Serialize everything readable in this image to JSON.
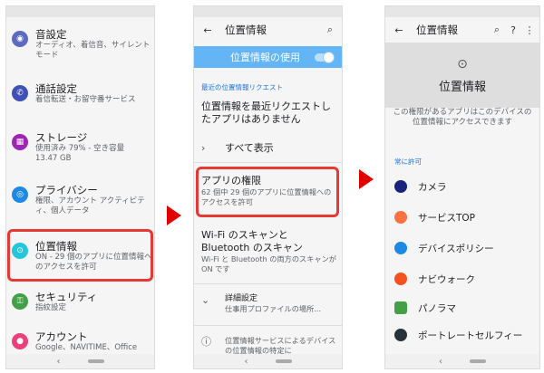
{
  "panel1": {
    "items": [
      {
        "title": "音設定",
        "sub": "オーディオ、着信音、サイレントモード",
        "color": "#5c6bc0",
        "icon": "speaker-icon"
      },
      {
        "title": "通話設定",
        "sub": "着信転送・お留守番サービス",
        "color": "#3f51b5",
        "icon": "phone-icon"
      },
      {
        "title": "ストレージ",
        "sub": "使用済み 79% - 空き容量 13.47 GB",
        "color": "#9c27b0",
        "icon": "storage-icon"
      },
      {
        "title": "プライバシー",
        "sub": "権限、アカウント アクティビティ、個人データ",
        "color": "#1e88e5",
        "icon": "eye-icon"
      },
      {
        "title": "位置情報",
        "sub": "ON - 29 個のアプリに位置情報へのアクセスを許可",
        "color": "#26c6da",
        "icon": "location-icon"
      },
      {
        "title": "セキュリティ",
        "sub": "指紋設定",
        "color": "#43a047",
        "icon": "lock-icon"
      },
      {
        "title": "アカウント",
        "sub": "Google、NAVITIME、Office",
        "color": "#ec407a",
        "icon": "account-icon"
      }
    ]
  },
  "panel2": {
    "title": "位置情報",
    "switch_label": "位置情報の使用",
    "recent_label": "最近の位置情報リクエスト",
    "no_requests": "位置情報を最近リクエストしたアプリはありません",
    "show_all": "すべて表示",
    "app_perm_title": "アプリの権限",
    "app_perm_sub": "62 個中 29 個のアプリに位置情報へのアクセスを許可",
    "scan_title": "Wi-Fi のスキャンと Bluetooth のスキャン",
    "scan_sub": "Wi-Fi と Bluetooth の両方のスキャンが ON です",
    "advanced_title": "詳細設定",
    "advanced_sub": "仕事用プロファイルの場所...",
    "info_text": "位置情報サービスによるデバイスの位置情報の特定に"
  },
  "panel3": {
    "title": "位置情報",
    "hero_title": "位置情報",
    "description": "この権限があるアプリはこのデバイスの位置情報にアクセスできます",
    "section": "常に許可",
    "apps": [
      {
        "name": "カメラ",
        "color": "#1a237e"
      },
      {
        "name": "サービスTOP",
        "color": "#ff7043"
      },
      {
        "name": "デバイスポリシー",
        "color": "#1e88e5"
      },
      {
        "name": "ナビウォーク",
        "color": "#f4511e"
      },
      {
        "name": "パノラマ",
        "color": "#43a047"
      },
      {
        "name": "ポートレートセルフィー",
        "color": "#263238"
      }
    ]
  },
  "colors": {
    "accent": "#e53935",
    "blue": "#64b5f6",
    "link": "#1a73e8"
  }
}
